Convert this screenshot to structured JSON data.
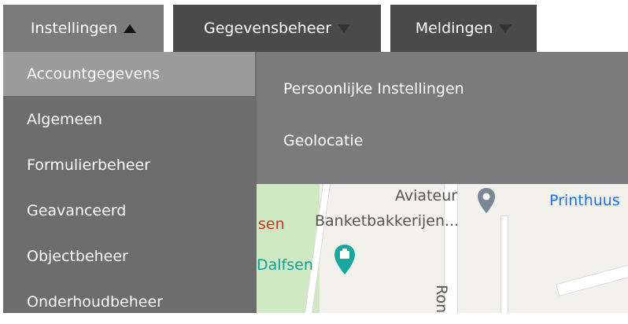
{
  "tabs": [
    {
      "label": "Instellingen",
      "arrow": "up-arrow-icon"
    },
    {
      "label": "Gegevensbeheer",
      "arrow": "down-arrow-icon"
    },
    {
      "label": "Meldingen",
      "arrow": "down-arrow-icon"
    }
  ],
  "menu": {
    "items": [
      {
        "label": "Accountgegevens",
        "active": true
      },
      {
        "label": "Algemeen"
      },
      {
        "label": "Formulierbeheer"
      },
      {
        "label": "Geavanceerd"
      },
      {
        "label": "Objectbeheer"
      },
      {
        "label": "Onderhoudbeheer"
      }
    ],
    "submenu": [
      {
        "label": "Persoonlijke Instellingen"
      },
      {
        "label": "Geolocatie"
      }
    ]
  },
  "map": {
    "labels": {
      "aviateur": "Aviateur",
      "banketbakkerijen": "Banketbakkerijen...",
      "printhuus": "Printhuus",
      "sen": "sen",
      "dalfsen": "Dalfsen",
      "ron": "Ron"
    }
  },
  "colors": {
    "tab_active": "#7b7b7b",
    "tab_inactive": "#4a4a4a",
    "menu_bg": "#6d6d6d",
    "menu_active": "#9b9b9b",
    "submenu_bg": "#7b7b7b"
  }
}
